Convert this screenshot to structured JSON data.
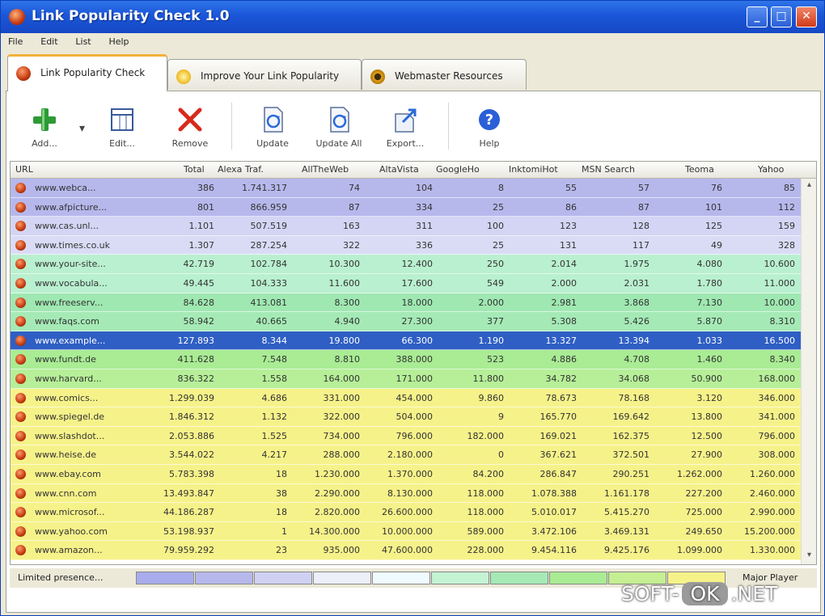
{
  "window": {
    "title": "Link Popularity Check 1.0",
    "min": "_",
    "max": "□",
    "close": "✕"
  },
  "menu": [
    "File",
    "Edit",
    "List",
    "Help"
  ],
  "tabs": [
    {
      "label": "Link Popularity Check",
      "icon": "red-ball-icon"
    },
    {
      "label": "Improve Your Link Popularity",
      "icon": "sun-icon"
    },
    {
      "label": "Webmaster Resources",
      "icon": "gear-icon"
    }
  ],
  "toolbar": {
    "add": "Add...",
    "edit": "Edit...",
    "remove": "Remove",
    "update": "Update",
    "update_all": "Update All",
    "export": "Export...",
    "help": "Help"
  },
  "columns": [
    "URL",
    "Total",
    "Alexa Traf.",
    "AllTheWeb",
    "AltaVista",
    "GoogleHo",
    "InktomiHot",
    "MSN Search",
    "Teoma",
    "Yahoo"
  ],
  "rows": [
    {
      "url": "www.webca...",
      "vals": [
        "386",
        "1.741.317",
        "74",
        "104",
        "8",
        "55",
        "57",
        "76",
        "85"
      ],
      "color": "#b6b8ec"
    },
    {
      "url": "www.afpicture...",
      "vals": [
        "801",
        "866.959",
        "87",
        "334",
        "25",
        "86",
        "87",
        "101",
        "112"
      ],
      "color": "#b6b8ec"
    },
    {
      "url": "www.cas.unl...",
      "vals": [
        "1.101",
        "507.519",
        "163",
        "311",
        "100",
        "123",
        "128",
        "125",
        "159"
      ],
      "color": "#d4d5f4"
    },
    {
      "url": "www.times.co.uk",
      "vals": [
        "1.307",
        "287.254",
        "322",
        "336",
        "25",
        "131",
        "117",
        "49",
        "328"
      ],
      "color": "#dadcf6"
    },
    {
      "url": "www.your-site...",
      "vals": [
        "42.719",
        "102.784",
        "10.300",
        "12.400",
        "250",
        "2.014",
        "1.975",
        "4.080",
        "10.600"
      ],
      "color": "#b9f0cf"
    },
    {
      "url": "www.vocabula...",
      "vals": [
        "49.445",
        "104.333",
        "11.600",
        "17.600",
        "549",
        "2.000",
        "2.031",
        "1.780",
        "11.000"
      ],
      "color": "#b9f0cf"
    },
    {
      "url": "www.freeserv...",
      "vals": [
        "84.628",
        "413.081",
        "8.300",
        "18.000",
        "2.000",
        "2.981",
        "3.868",
        "7.130",
        "10.000"
      ],
      "color": "#9fe8b2"
    },
    {
      "url": "www.faqs.com",
      "vals": [
        "58.942",
        "40.665",
        "4.940",
        "27.300",
        "377",
        "5.308",
        "5.426",
        "5.870",
        "8.310"
      ],
      "color": "#a5eab6"
    },
    {
      "url": "www.example...",
      "vals": [
        "127.893",
        "8.344",
        "19.800",
        "66.300",
        "1.190",
        "13.327",
        "13.394",
        "1.033",
        "16.500"
      ],
      "color": "#2f5fc4",
      "selected": true
    },
    {
      "url": "www.fundt.de",
      "vals": [
        "411.628",
        "7.548",
        "8.810",
        "388.000",
        "523",
        "4.886",
        "4.708",
        "1.460",
        "8.340"
      ],
      "color": "#a9ec94"
    },
    {
      "url": "www.harvard...",
      "vals": [
        "836.322",
        "1.558",
        "164.000",
        "171.000",
        "11.800",
        "34.782",
        "34.068",
        "50.900",
        "168.000"
      ],
      "color": "#b6ef98"
    },
    {
      "url": "www.comics...",
      "vals": [
        "1.299.039",
        "4.686",
        "331.000",
        "454.000",
        "9.860",
        "78.673",
        "78.168",
        "3.120",
        "346.000"
      ],
      "color": "#f6f28a"
    },
    {
      "url": "www.spiegel.de",
      "vals": [
        "1.846.312",
        "1.132",
        "322.000",
        "504.000",
        "9",
        "165.770",
        "169.642",
        "13.800",
        "341.000"
      ],
      "color": "#f6f28a"
    },
    {
      "url": "www.slashdot...",
      "vals": [
        "2.053.886",
        "1.525",
        "734.000",
        "796.000",
        "182.000",
        "169.021",
        "162.375",
        "12.500",
        "796.000"
      ],
      "color": "#f6f28a"
    },
    {
      "url": "www.heise.de",
      "vals": [
        "3.544.022",
        "4.217",
        "288.000",
        "2.180.000",
        "0",
        "367.621",
        "372.501",
        "27.900",
        "308.000"
      ],
      "color": "#f6f28a"
    },
    {
      "url": "www.ebay.com",
      "vals": [
        "5.783.398",
        "18",
        "1.230.000",
        "1.370.000",
        "84.200",
        "286.847",
        "290.251",
        "1.262.000",
        "1.260.000"
      ],
      "color": "#f6f28a"
    },
    {
      "url": "www.cnn.com",
      "vals": [
        "13.493.847",
        "38",
        "2.290.000",
        "8.130.000",
        "118.000",
        "1.078.388",
        "1.161.178",
        "227.200",
        "2.460.000"
      ],
      "color": "#f6f28a"
    },
    {
      "url": "www.microsof...",
      "vals": [
        "44.186.287",
        "18",
        "2.820.000",
        "26.600.000",
        "118.000",
        "5.010.017",
        "5.415.270",
        "725.000",
        "2.990.000"
      ],
      "color": "#f6f28a"
    },
    {
      "url": "www.yahoo.com",
      "vals": [
        "53.198.937",
        "1",
        "14.300.000",
        "10.000.000",
        "589.000",
        "3.472.106",
        "3.469.131",
        "249.650",
        "15.200.000"
      ],
      "color": "#f6f28a"
    },
    {
      "url": "www.amazon...",
      "vals": [
        "79.959.292",
        "23",
        "935.000",
        "47.600.000",
        "228.000",
        "9.454.116",
        "9.425.176",
        "1.099.000",
        "1.330.000"
      ],
      "color": "#f6f28a"
    }
  ],
  "legend": {
    "left": "Limited presence...",
    "right": "Major Player",
    "swatches": [
      "#a9acec",
      "#b6b8ec",
      "#cfd1f3",
      "#eceefa",
      "#f0fbff",
      "#c4f3d4",
      "#a5eab6",
      "#a9ec94",
      "#c5ef92",
      "#f6f28a"
    ]
  },
  "watermark": {
    "left": "SOFT-",
    "mid": "OK",
    "right": ".NET"
  }
}
